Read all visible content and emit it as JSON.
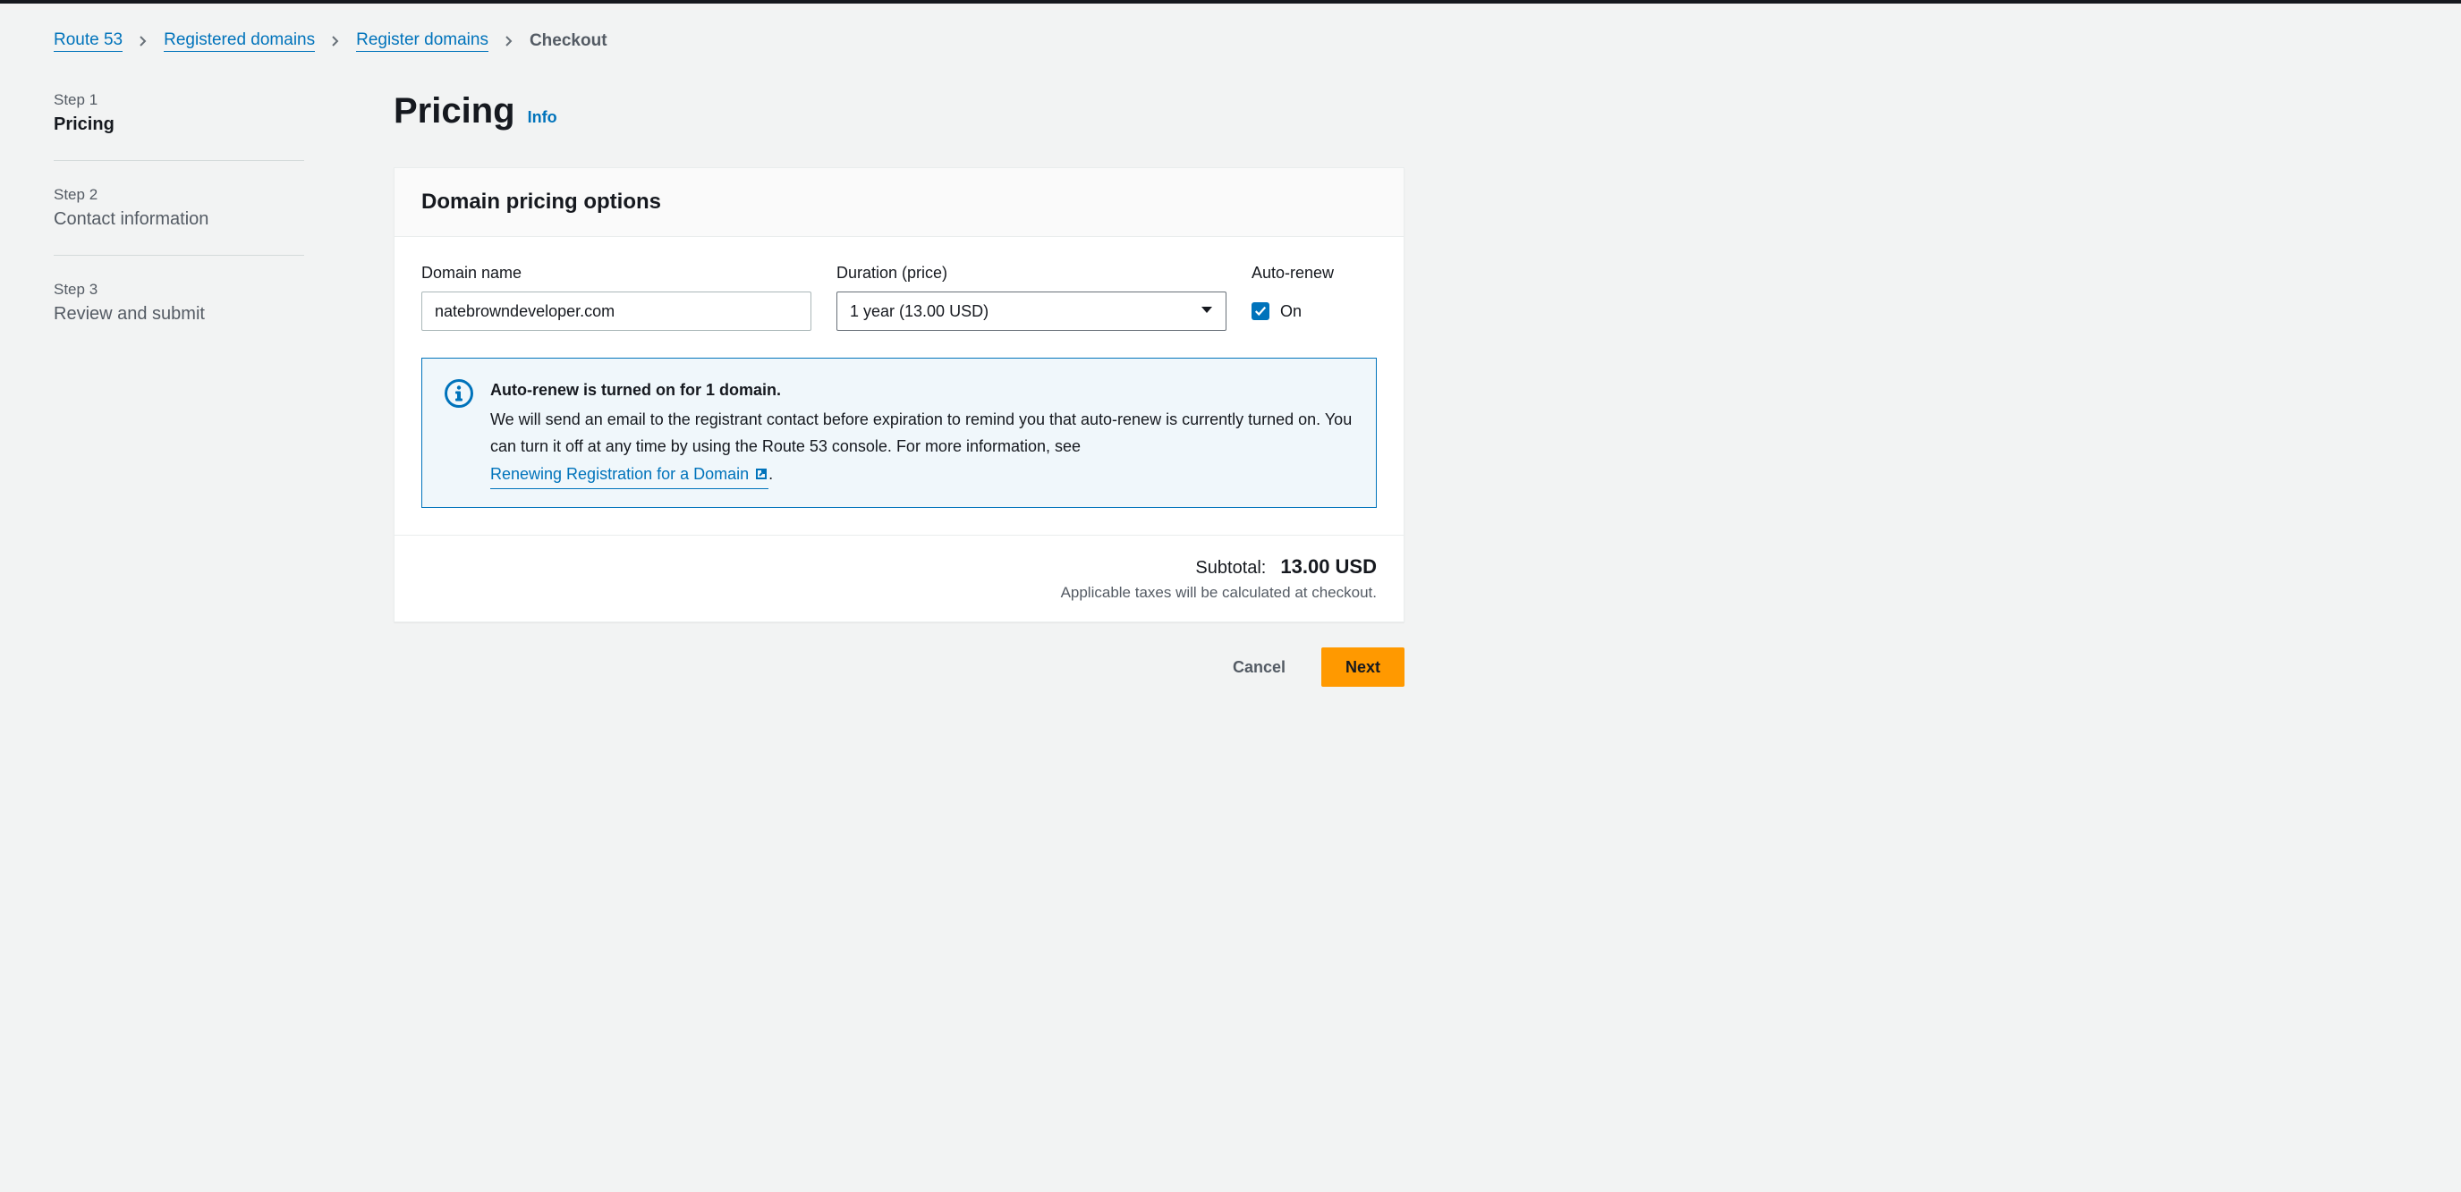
{
  "breadcrumb": {
    "items": [
      {
        "label": "Route 53",
        "link": true
      },
      {
        "label": "Registered domains",
        "link": true
      },
      {
        "label": "Register domains",
        "link": true
      },
      {
        "label": "Checkout",
        "link": false
      }
    ]
  },
  "wizard": {
    "steps": [
      {
        "number": "Step 1",
        "title": "Pricing"
      },
      {
        "number": "Step 2",
        "title": "Contact information"
      },
      {
        "number": "Step 3",
        "title": "Review and submit"
      }
    ]
  },
  "header": {
    "title": "Pricing",
    "info_label": "Info"
  },
  "panel": {
    "title": "Domain pricing options",
    "labels": {
      "domain_name": "Domain name",
      "duration": "Duration (price)",
      "auto_renew": "Auto-renew"
    },
    "domain_name_value": "natebrowndeveloper.com",
    "duration_value": "1 year (13.00 USD)",
    "auto_renew_state": "On"
  },
  "alert": {
    "title": "Auto-renew is turned on for 1 domain.",
    "text": "We will send an email to the registrant contact before expiration to remind you that auto-renew is currently turned on. You can turn it off at any time by using the Route 53 console. For more information, see ",
    "link_label": "Renewing Registration for a Domain ",
    "period": "."
  },
  "subtotal": {
    "label": "Subtotal:",
    "value": "13.00 USD",
    "tax_note": "Applicable taxes will be calculated at checkout."
  },
  "actions": {
    "cancel": "Cancel",
    "next": "Next"
  }
}
